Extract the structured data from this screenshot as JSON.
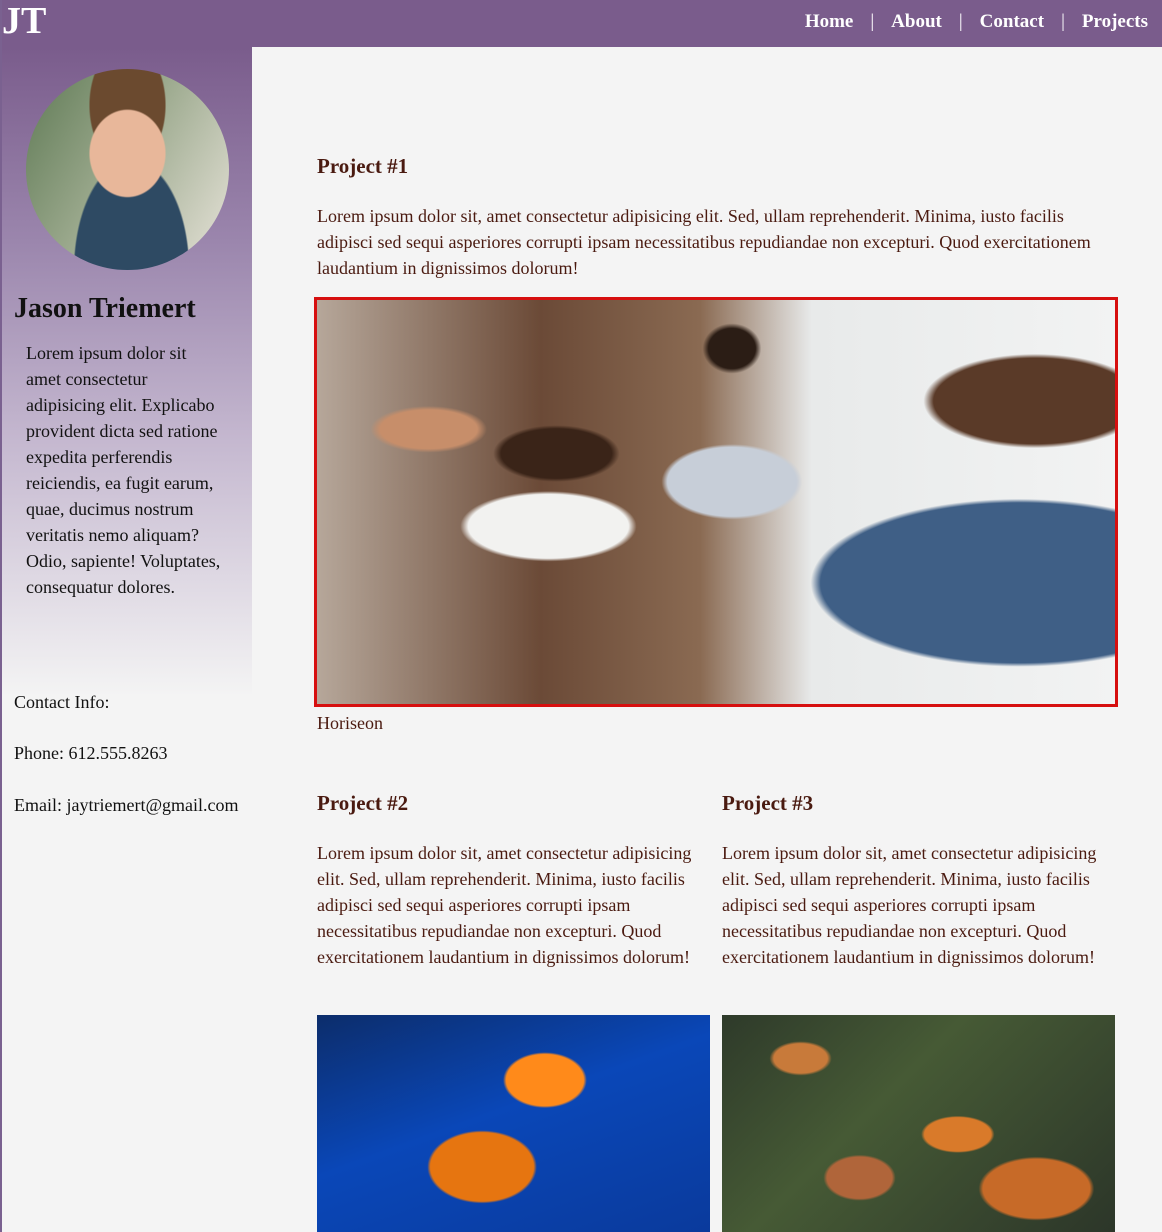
{
  "header": {
    "logo": "JT",
    "nav": [
      {
        "label": "Home"
      },
      {
        "label": "About"
      },
      {
        "label": "Contact"
      },
      {
        "label": "Projects"
      }
    ],
    "separator": "|"
  },
  "sidebar": {
    "name": "Jason Triemert",
    "bio": "Lorem ipsum dolor sit amet consectetur adipisicing elit. Explicabo provident dicta sed ratione expedita perferendis reiciendis, ea fugit earum, quae, ducimus nostrum veritatis nemo aliquam? Odio, sapiente! Voluptates, consequatur dolores.",
    "contact_heading": "Contact Info:",
    "phone": "Phone: 612.555.8263",
    "email": "Email: jaytriemert@gmail.com"
  },
  "projects": [
    {
      "title": "Project #1",
      "text": "Lorem ipsum dolor sit, amet consectetur adipisicing elit. Sed, ullam reprehenderit. Minima, iusto facilis adipisci sed sequi asperiores corrupti ipsam necessitatibus repudiandae non excepturi. Quod exercitationem laudantium in dignissimos dolorum!",
      "caption": "Horiseon"
    },
    {
      "title": "Project #2",
      "text": "Lorem ipsum dolor sit, amet consectetur adipisicing elit. Sed, ullam reprehenderit. Minima, iusto facilis adipisci sed sequi asperiores corrupti ipsam necessitatibus repudiandae non excepturi. Quod exercitationem laudantium in dignissimos dolorum!"
    },
    {
      "title": "Project #3",
      "text": "Lorem ipsum dolor sit, amet consectetur adipisicing elit. Sed, ullam reprehenderit. Minima, iusto facilis adipisci sed sequi asperiores corrupti ipsam necessitatibus repudiandae non excepturi. Quod exercitationem laudantium in dignissimos dolorum!"
    }
  ],
  "colors": {
    "header_bg": "#7a5c8c",
    "text": "#4a1a10",
    "highlight_border": "#d60f0f"
  }
}
